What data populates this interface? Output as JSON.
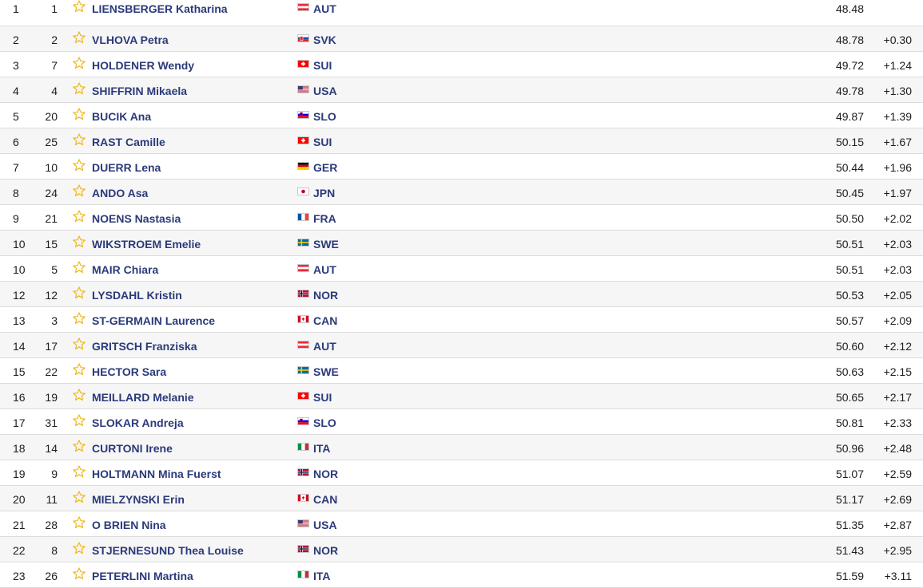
{
  "colors": {
    "name_link": "#2b3a7a",
    "star": "#f0b81c",
    "row_alt": "#f6f6f6",
    "divider": "#dcdcdc"
  },
  "star_icon": "star-outline-icon",
  "results": [
    {
      "rank": "1",
      "bib": "1",
      "name": "LIENSBERGER Katharina",
      "nation": "AUT",
      "time": "48.48",
      "diff": ""
    },
    {
      "rank": "2",
      "bib": "2",
      "name": "VLHOVA Petra",
      "nation": "SVK",
      "time": "48.78",
      "diff": "+0.30"
    },
    {
      "rank": "3",
      "bib": "7",
      "name": "HOLDENER Wendy",
      "nation": "SUI",
      "time": "49.72",
      "diff": "+1.24"
    },
    {
      "rank": "4",
      "bib": "4",
      "name": "SHIFFRIN Mikaela",
      "nation": "USA",
      "time": "49.78",
      "diff": "+1.30"
    },
    {
      "rank": "5",
      "bib": "20",
      "name": "BUCIK Ana",
      "nation": "SLO",
      "time": "49.87",
      "diff": "+1.39"
    },
    {
      "rank": "6",
      "bib": "25",
      "name": "RAST Camille",
      "nation": "SUI",
      "time": "50.15",
      "diff": "+1.67"
    },
    {
      "rank": "7",
      "bib": "10",
      "name": "DUERR Lena",
      "nation": "GER",
      "time": "50.44",
      "diff": "+1.96"
    },
    {
      "rank": "8",
      "bib": "24",
      "name": "ANDO Asa",
      "nation": "JPN",
      "time": "50.45",
      "diff": "+1.97"
    },
    {
      "rank": "9",
      "bib": "21",
      "name": "NOENS Nastasia",
      "nation": "FRA",
      "time": "50.50",
      "diff": "+2.02"
    },
    {
      "rank": "10",
      "bib": "15",
      "name": "WIKSTROEM Emelie",
      "nation": "SWE",
      "time": "50.51",
      "diff": "+2.03"
    },
    {
      "rank": "10",
      "bib": "5",
      "name": "MAIR Chiara",
      "nation": "AUT",
      "time": "50.51",
      "diff": "+2.03"
    },
    {
      "rank": "12",
      "bib": "12",
      "name": "LYSDAHL Kristin",
      "nation": "NOR",
      "time": "50.53",
      "diff": "+2.05"
    },
    {
      "rank": "13",
      "bib": "3",
      "name": "ST-GERMAIN Laurence",
      "nation": "CAN",
      "time": "50.57",
      "diff": "+2.09"
    },
    {
      "rank": "14",
      "bib": "17",
      "name": "GRITSCH Franziska",
      "nation": "AUT",
      "time": "50.60",
      "diff": "+2.12"
    },
    {
      "rank": "15",
      "bib": "22",
      "name": "HECTOR Sara",
      "nation": "SWE",
      "time": "50.63",
      "diff": "+2.15"
    },
    {
      "rank": "16",
      "bib": "19",
      "name": "MEILLARD Melanie",
      "nation": "SUI",
      "time": "50.65",
      "diff": "+2.17"
    },
    {
      "rank": "17",
      "bib": "31",
      "name": "SLOKAR Andreja",
      "nation": "SLO",
      "time": "50.81",
      "diff": "+2.33"
    },
    {
      "rank": "18",
      "bib": "14",
      "name": "CURTONI Irene",
      "nation": "ITA",
      "time": "50.96",
      "diff": "+2.48"
    },
    {
      "rank": "19",
      "bib": "9",
      "name": "HOLTMANN Mina Fuerst",
      "nation": "NOR",
      "time": "51.07",
      "diff": "+2.59"
    },
    {
      "rank": "20",
      "bib": "11",
      "name": "MIELZYNSKI Erin",
      "nation": "CAN",
      "time": "51.17",
      "diff": "+2.69"
    },
    {
      "rank": "21",
      "bib": "28",
      "name": "O BRIEN Nina",
      "nation": "USA",
      "time": "51.35",
      "diff": "+2.87"
    },
    {
      "rank": "22",
      "bib": "8",
      "name": "STJERNESUND Thea Louise",
      "nation": "NOR",
      "time": "51.43",
      "diff": "+2.95"
    },
    {
      "rank": "23",
      "bib": "26",
      "name": "PETERLINI Martina",
      "nation": "ITA",
      "time": "51.59",
      "diff": "+3.11"
    }
  ]
}
